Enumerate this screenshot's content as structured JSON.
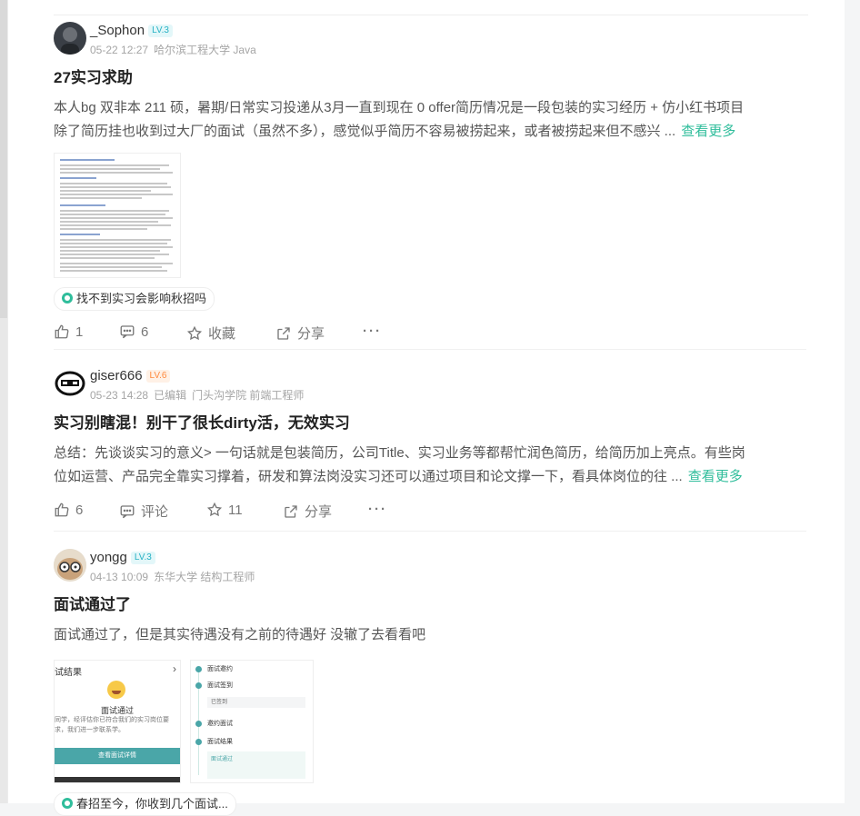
{
  "posts": [
    {
      "username": "_Sophon",
      "level": "LV.3",
      "time": "05-22 12:27",
      "edited": "",
      "school": "哈尔滨工程大学 Java",
      "title": "27实习求助",
      "body_line1": "本人bg 双非本 211 硕，暑期/日常实习投递从3月一直到现在 0 offer简历情况是一段包装的实习经历 + 仿小红书项目",
      "body_line2": "除了简历挂也收到过大厂的面试（虽然不多），感觉似乎简历不容易被捞起来，或者被捞起来但不感兴 ...",
      "more": "查看更多",
      "tag": "找不到实习会影响秋招吗",
      "likes": "1",
      "comments": "6",
      "favorite": "收藏",
      "share": "分享"
    },
    {
      "username": "giser666",
      "level": "LV.6",
      "time": "05-23 14:28",
      "edited": "已编辑",
      "school": "门头沟学院 前端工程师",
      "title": "实习别瞎混！别干了很长dirty活，无效实习",
      "body_line1": "总结：先谈谈实习的意义> 一句话就是包装简历，公司Title、实习业务等都帮忙润色简历，给简历加上亮点。有些岗",
      "body_line2": "位如运营、产品完全靠实习撑着，研发和算法岗没实习还可以通过项目和论文撑一下，看具体岗位的往 ...",
      "more": "查看更多",
      "likes": "6",
      "comments": "评论",
      "favorite": "11",
      "share": "分享"
    },
    {
      "username": "yongg",
      "level": "LV.3",
      "time": "04-13 10:09",
      "edited": "",
      "school": "东华大学 结构工程师",
      "title": "面试通过了",
      "body_line1": "面试通过了，但是其实待遇没有之前的待遇好 没辙了去看看吧",
      "tag": "春招至今，你收到几个面试...",
      "shot1": {
        "header": "试结果",
        "pass": "面试通过",
        "desc": "同学，经评估你已符合我们的实习岗位要求，我们进一步联系学。",
        "button": "查看面试详情"
      },
      "shot2": {
        "steps": [
          "面试邀约",
          "面试签到",
          "已签到",
          "邀约面试",
          "面试结果"
        ],
        "passed": "面试通过"
      }
    }
  ],
  "colors": {
    "accent": "#2fbd9b",
    "level_cyan": "#27b1c4",
    "level_orange": "#ff8a3d"
  }
}
